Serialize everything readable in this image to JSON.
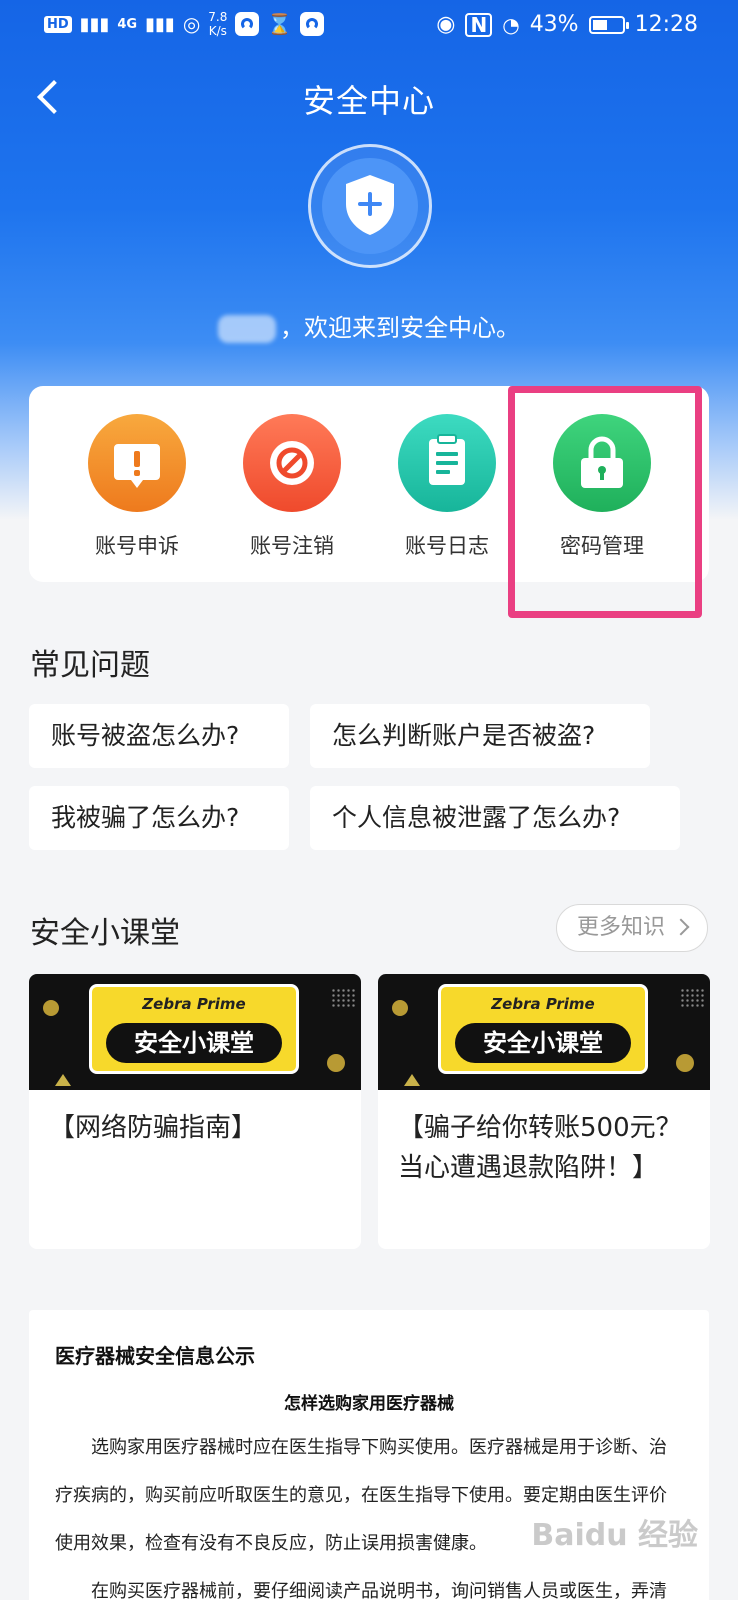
{
  "status_bar": {
    "hd": "HD",
    "net": "4G",
    "speed_value": "7.8",
    "speed_unit": "K/s",
    "battery": "43%",
    "time": "12:28"
  },
  "header": {
    "title": "安全中心",
    "welcome": "，欢迎来到安全中心。"
  },
  "actions": [
    {
      "label": "账号申诉",
      "color_top": "#f8a93e",
      "color_bottom": "#ee7a1d"
    },
    {
      "label": "账号注销",
      "color_top": "#ff7a58",
      "color_bottom": "#ef4a2c"
    },
    {
      "label": "账号日志",
      "color_top": "#3ddbc1",
      "color_bottom": "#17b59a"
    },
    {
      "label": "密码管理",
      "color_top": "#3fd47d",
      "color_bottom": "#1fb05b"
    }
  ],
  "faq": {
    "title": "常见问题",
    "items": [
      "账号被盗怎么办?",
      "怎么判断账户是否被盗?",
      "我被骗了怎么办?",
      "个人信息被泄露了怎么办?"
    ]
  },
  "courses": {
    "title": "安全小课堂",
    "more_label": "更多知识",
    "items": [
      {
        "brand": "Zebra Prime",
        "banner_text": "安全小课堂",
        "title": "【网络防骗指南】"
      },
      {
        "brand": "Zebra Prime",
        "banner_text": "安全小课堂",
        "title": "【骗子给你转账500元？当心遭遇退款陷阱！】"
      }
    ]
  },
  "notice": {
    "title": "医疗器械安全信息公示",
    "subtitle": "怎样选购家用医疗器械",
    "p1": "选购家用医疗器械时应在医生指导下购买使用。医疗器械是用于诊断、治疗疾病的，购买前应听取医生的意见，在医生指导下使用。要定期由医生评价使用效果，检查有没有不良反应，防止误用损害健康。",
    "p2": "在购买医疗器械前，要仔细阅读产品说明书，询问销售人员或医生，弄清产"
  },
  "watermark": "Baidu 经验",
  "highlight_color": "#ea3f82"
}
